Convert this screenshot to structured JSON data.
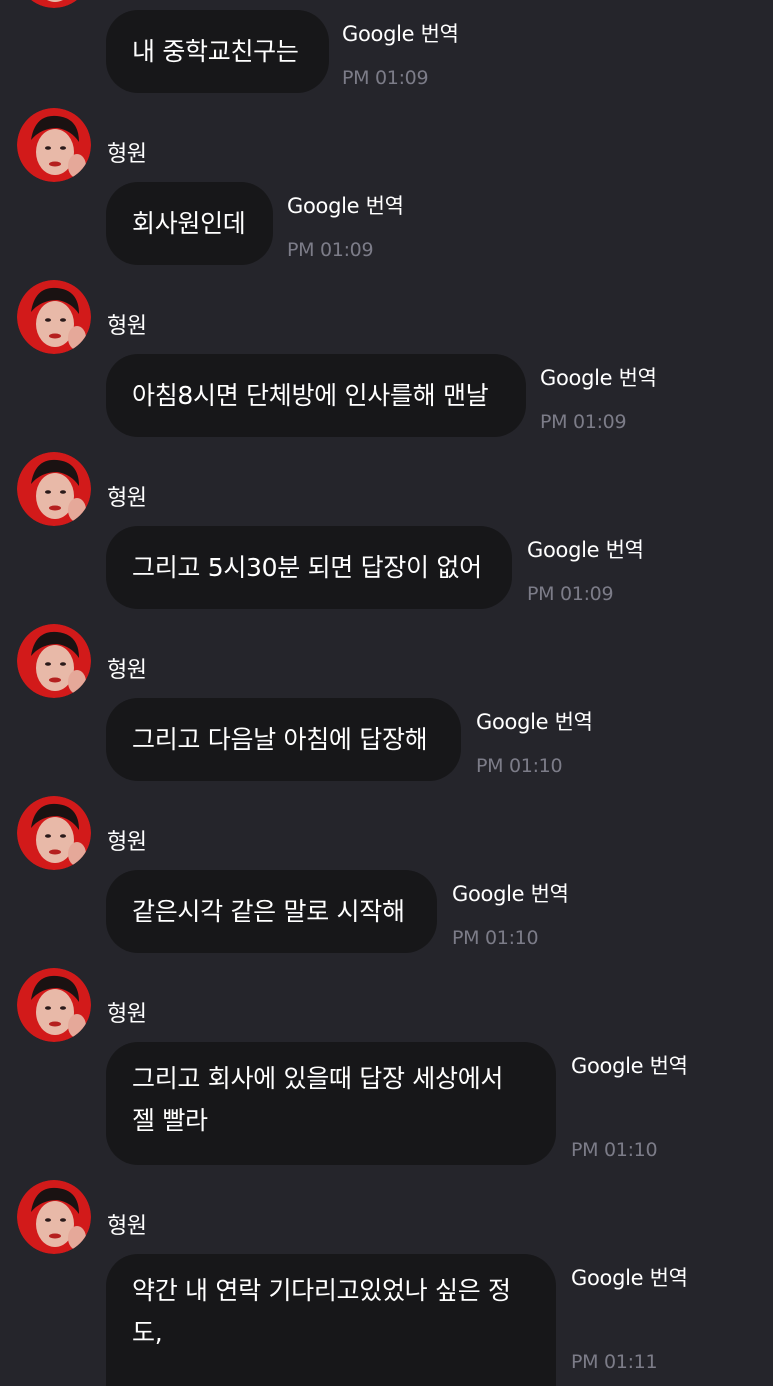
{
  "sender_name": "형원",
  "translate_label": "Google 번역",
  "messages": [
    {
      "text": "내 중학교친구는",
      "time": "PM 01:09"
    },
    {
      "text": "회사원인데",
      "time": "PM 01:09"
    },
    {
      "text": "아침8시면 단체방에 인사를해 맨날",
      "time": "PM 01:09"
    },
    {
      "text": "그리고 5시30분 되면 답장이 없어",
      "time": "PM 01:09"
    },
    {
      "text": "그리고 다음날 아침에 답장해",
      "time": "PM 01:10"
    },
    {
      "text": "같은시각 같은 말로 시작해",
      "time": "PM 01:10"
    },
    {
      "text": "그리고 회사에 있을때 답장 세상에서\n젤 빨라",
      "time": "PM 01:10"
    },
    {
      "text": "약간 내 연락 기다리고있었나 싶은 정\n도,",
      "time": "PM 01:11"
    }
  ],
  "colors": {
    "background": "#25252b",
    "bubble": "#171719",
    "time": "#7c7c88",
    "avatar_accent": "#d21a1a"
  }
}
